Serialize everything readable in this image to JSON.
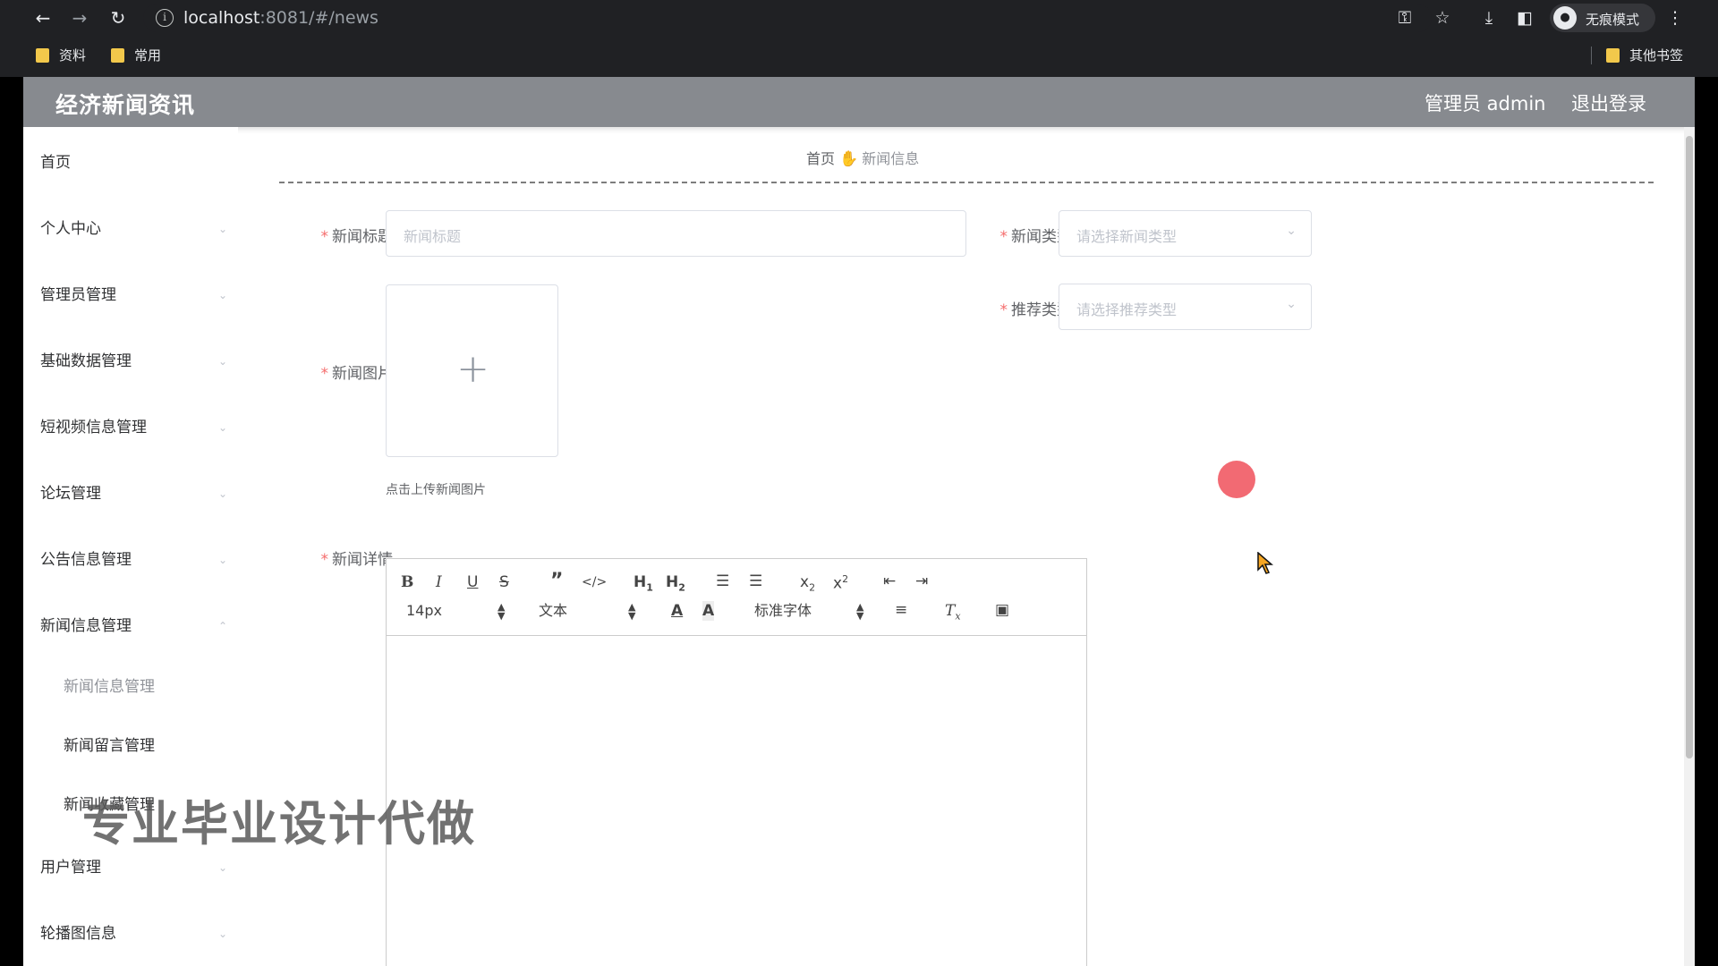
{
  "browser": {
    "url_host": "localhost",
    "url_path": ":8081/#/news",
    "profile_label": "无痕模式",
    "bookmarks": [
      "资料",
      "常用"
    ],
    "other_bookmarks": "其他书签"
  },
  "header": {
    "title": "经济新闻资讯",
    "admin_label": "管理员 admin",
    "logout_label": "退出登录"
  },
  "sidebar": {
    "items": [
      {
        "label": "首页"
      },
      {
        "label": "个人中心"
      },
      {
        "label": "管理员管理"
      },
      {
        "label": "基础数据管理"
      },
      {
        "label": "短视频信息管理"
      },
      {
        "label": "论坛管理"
      },
      {
        "label": "公告信息管理"
      },
      {
        "label": "新闻信息管理",
        "expanded": true
      },
      {
        "label": "用户管理"
      },
      {
        "label": "轮播图信息"
      }
    ],
    "subitems": [
      {
        "label": "新闻信息管理",
        "active": true
      },
      {
        "label": "新闻留言管理"
      },
      {
        "label": "新闻收藏管理"
      }
    ]
  },
  "breadcrumb": {
    "home": "首页",
    "current": "新闻信息"
  },
  "form": {
    "title_label": "新闻标题",
    "title_placeholder": "新闻标题",
    "type_label": "新闻类型",
    "type_placeholder": "请选择新闻类型",
    "recommend_label": "推荐类型",
    "recommend_placeholder": "请选择推荐类型",
    "image_label": "新闻图片",
    "upload_tip": "点击上传新闻图片",
    "detail_label": "新闻详情"
  },
  "editor": {
    "font_size": "14px",
    "header_select": "文本",
    "font_family": "标准字体"
  },
  "watermark": "专业毕业设计代做"
}
